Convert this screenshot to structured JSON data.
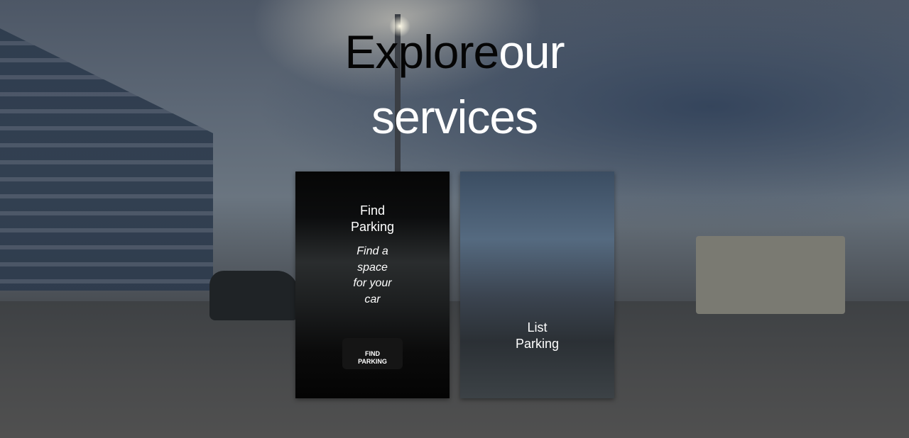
{
  "hero": {
    "title_word1": "Explore",
    "title_word2": "our",
    "title_line2": "services"
  },
  "cards": [
    {
      "title_line1": "Find",
      "title_line2": "Parking",
      "subtitle": "Find a space for your car",
      "button_label_line1": "FIND",
      "button_label_line2": "PARKING"
    },
    {
      "title_line1": "List",
      "title_line2": "Parking"
    }
  ]
}
